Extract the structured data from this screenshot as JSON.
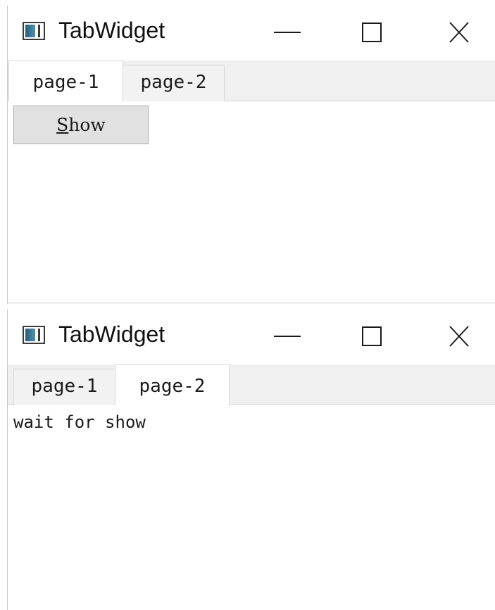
{
  "windows": [
    {
      "title": "TabWidget",
      "active_tab": 0,
      "tabs": [
        {
          "label": "page-1"
        },
        {
          "label": "page-2"
        }
      ],
      "button": {
        "mnemonic": "S",
        "rest": "how"
      }
    },
    {
      "title": "TabWidget",
      "active_tab": 1,
      "tabs": [
        {
          "label": "page-1"
        },
        {
          "label": "page-2"
        }
      ],
      "label_text": "wait for show"
    }
  ],
  "icons": {
    "app": "app-window-icon",
    "minimize": "minimize-icon",
    "maximize": "maximize-icon",
    "close": "close-icon"
  },
  "colors": {
    "tabbar_bg": "#f0f0f0",
    "button_bg": "#e1e1e1",
    "icon_fill": "#3b7a9a"
  }
}
